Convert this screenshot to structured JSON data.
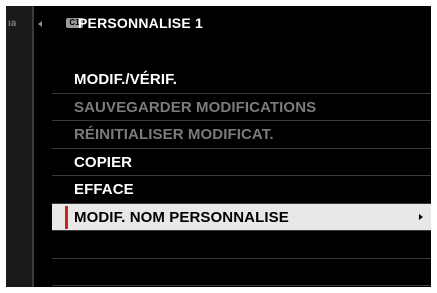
{
  "side_tab": {
    "label": "ıa"
  },
  "header": {
    "icon": "custom-setting-icon",
    "icon_text": "C1",
    "title": "PERSONNALISE 1"
  },
  "menu": {
    "items": [
      {
        "label": "MODIF./VÉRIF.",
        "state": "enabled"
      },
      {
        "label": "SAUVEGARDER MODIFICATIONS",
        "state": "disabled"
      },
      {
        "label": "RÉINITIALISER MODIFICAT.",
        "state": "disabled"
      },
      {
        "label": "COPIER",
        "state": "enabled"
      },
      {
        "label": "EFFACE",
        "state": "enabled"
      },
      {
        "label": "MODIF. NOM PERSONNALISE",
        "state": "selected",
        "submenu": true
      }
    ]
  },
  "colors": {
    "background": "#000000",
    "enabled_text": "#ffffff",
    "disabled_text": "#7b7b7b",
    "selected_bg": "#e8e8e8",
    "selected_marker": "#d02020"
  }
}
